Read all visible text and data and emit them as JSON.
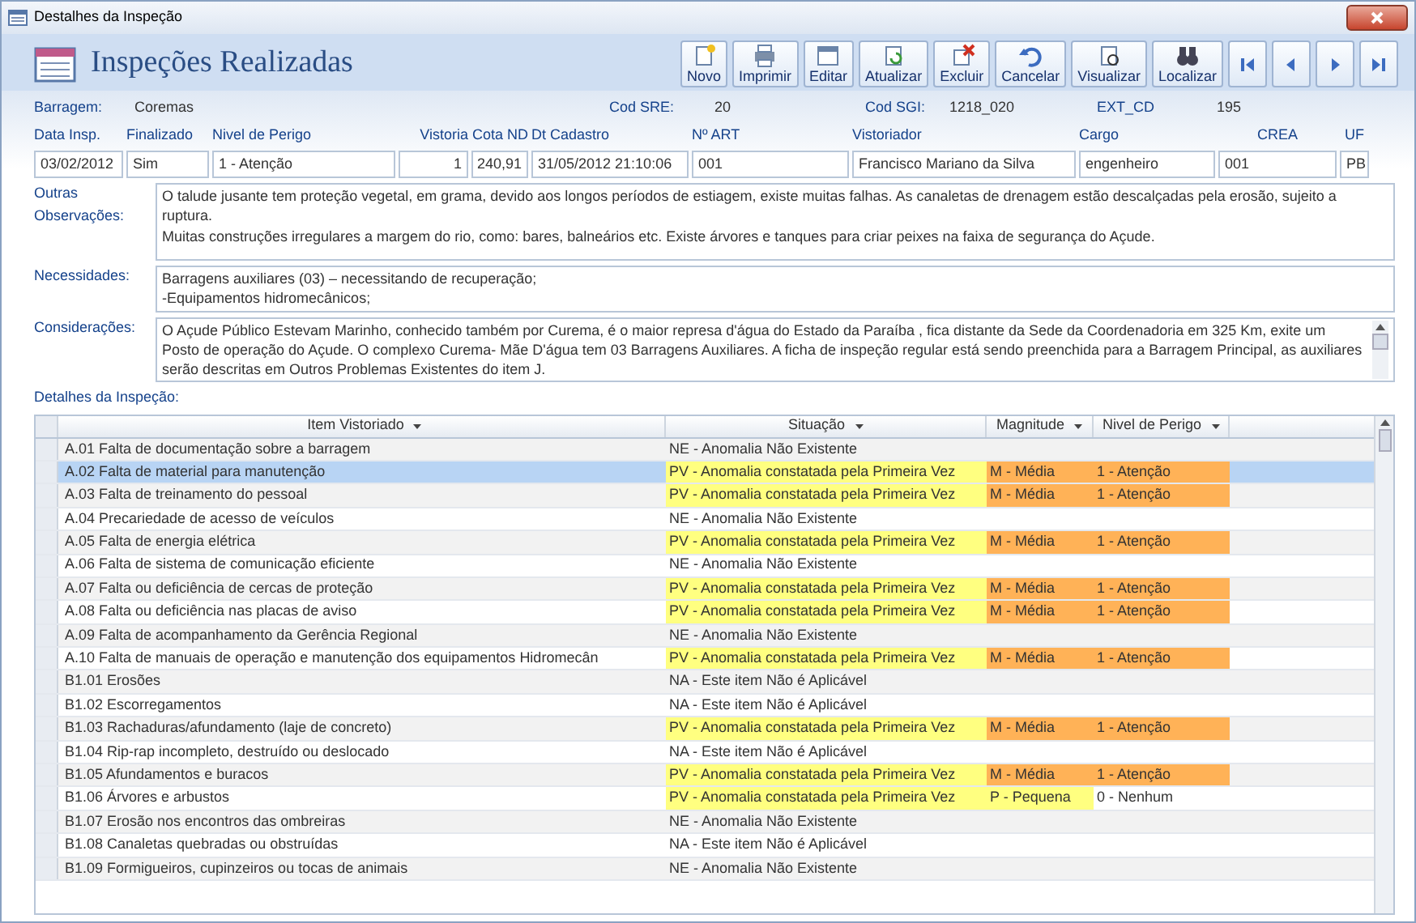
{
  "window": {
    "title": "Destalhes da Inspeção"
  },
  "form_title": "Inspeções Realizadas",
  "toolbar": [
    {
      "label": "Novo",
      "kind": "new"
    },
    {
      "label": "Imprimir",
      "kind": "print"
    },
    {
      "label": "Editar",
      "kind": "edit"
    },
    {
      "label": "Atualizar",
      "kind": "refresh"
    },
    {
      "label": "Excluir",
      "kind": "delete"
    },
    {
      "label": "Cancelar",
      "kind": "undo"
    },
    {
      "label": "Visualizar",
      "kind": "preview"
    },
    {
      "label": "Localizar",
      "kind": "find"
    }
  ],
  "navigation": [
    {
      "kind": "first"
    },
    {
      "kind": "prev"
    },
    {
      "kind": "next"
    },
    {
      "kind": "last"
    }
  ],
  "info": [
    {
      "label": "Barragem:",
      "value": "Coremas"
    },
    {
      "label": "Cod SRE:",
      "value": "20"
    },
    {
      "label": "Cod SGI:",
      "value": "1218_020"
    },
    {
      "label": "EXT_CD",
      "value": "195"
    }
  ],
  "fields": [
    {
      "label": "Data Insp.",
      "value": "03/02/2012"
    },
    {
      "label": "Finalizado",
      "value": "Sim"
    },
    {
      "label": "Nivel de Perigo",
      "value": "1 - Atenção"
    },
    {
      "label": "Vistoria",
      "value": "1"
    },
    {
      "label": "Cota ND",
      "value": "240,91"
    },
    {
      "label": "Dt Cadastro",
      "value": "31/05/2012 21:10:06"
    },
    {
      "label": "Nº ART",
      "value": "001"
    },
    {
      "label": "Vistoriador",
      "value": "Francisco Mariano da Silva"
    },
    {
      "label": "Cargo",
      "value": "engenheiro"
    },
    {
      "label": "CREA",
      "value": "001"
    },
    {
      "label": "UF",
      "value": "PB"
    }
  ],
  "memos": [
    {
      "label": "Outras Observações:",
      "lines": [
        "O talude jusante tem proteção vegetal, em grama, devido aos longos períodos de estiagem, existe muitas falhas. As canaletas de drenagem estão descalçadas pela erosão, sujeito a ruptura.",
        "Muitas construções irregulares a margem do rio, como: bares, balneários etc. Existe árvores e tanques para criar peixes na faixa de segurança do Açude."
      ]
    },
    {
      "label": "Necessidades:",
      "lines": [
        "Barragens auxiliares (03) – necessitando de recuperação;",
        "-Equipamentos hidromecânicos;"
      ]
    },
    {
      "label": "Considerações:",
      "lines": [
        "O Açude Público Estevam Marinho, conhecido também por  Curema, é o maior represa d'água do Estado da Paraíba , fica distante da Sede da Coordenadoria em 325 Km, exite um Posto de operação do Açude. O complexo Curema- Mãe D'água tem 03 Barragens Auxiliares. A ficha de inspeção regular está  sendo preenchida para a Barragem Principal, as auxiliares serão descritas em Outros Problemas Existentes do item J."
      ]
    }
  ],
  "details": {
    "title": "Detalhes da Inspeção:",
    "columns": [
      "Item Vistoriado",
      "Situação",
      "Magnitude",
      "Nivel de Perigo"
    ],
    "rows": [
      {
        "item": "A.01  Falta de documentação sobre a barragem",
        "situation": {
          "text": "NE - Anomalia Não Existente"
        },
        "selected": false
      },
      {
        "item": "A.02  Falta de material para manutenção",
        "situation": {
          "text": "PV - Anomalia constatada pela Primeira Vez",
          "color": "#ffff80"
        },
        "magnitude": {
          "text": "M - Média",
          "color": "#ffb257"
        },
        "danger": {
          "text": "1 - Atenção",
          "color": "#ffb257"
        },
        "selected": true
      },
      {
        "item": "A.03  Falta de treinamento do pessoal",
        "situation": {
          "text": "PV - Anomalia constatada pela Primeira Vez",
          "color": "#ffff80"
        },
        "magnitude": {
          "text": "M - Média",
          "color": "#ffb257"
        },
        "danger": {
          "text": "1 - Atenção",
          "color": "#ffb257"
        },
        "selected": false
      },
      {
        "item": "A.04  Precariedade de acesso de veículos",
        "situation": {
          "text": "NE - Anomalia Não Existente"
        },
        "selected": false
      },
      {
        "item": "A.05  Falta de energia elétrica",
        "situation": {
          "text": "PV - Anomalia constatada pela Primeira Vez",
          "color": "#ffff80"
        },
        "magnitude": {
          "text": "M - Média",
          "color": "#ffb257"
        },
        "danger": {
          "text": "1 - Atenção",
          "color": "#ffb257"
        },
        "selected": false
      },
      {
        "item": "A.06  Falta de sistema de comunicação eficiente",
        "situation": {
          "text": "NE - Anomalia Não Existente"
        },
        "selected": false
      },
      {
        "item": "A.07  Falta ou deficiência de cercas de proteção",
        "situation": {
          "text": "PV - Anomalia constatada pela Primeira Vez",
          "color": "#ffff80"
        },
        "magnitude": {
          "text": "M - Média",
          "color": "#ffb257"
        },
        "danger": {
          "text": "1 - Atenção",
          "color": "#ffb257"
        },
        "selected": false
      },
      {
        "item": "A.08  Falta ou deficiência nas placas de aviso",
        "situation": {
          "text": "PV - Anomalia constatada pela Primeira Vez",
          "color": "#ffff80"
        },
        "magnitude": {
          "text": "M - Média",
          "color": "#ffb257"
        },
        "danger": {
          "text": "1 - Atenção",
          "color": "#ffb257"
        },
        "selected": false
      },
      {
        "item": "A.09  Falta de acompanhamento da Gerência Regional",
        "situation": {
          "text": "NE - Anomalia Não Existente"
        },
        "selected": false
      },
      {
        "item": "A.10  Falta de manuais de operação e manutenção dos equipamentos Hidromecân",
        "situation": {
          "text": "PV - Anomalia constatada pela Primeira Vez",
          "color": "#ffff80"
        },
        "magnitude": {
          "text": "M - Média",
          "color": "#ffb257"
        },
        "danger": {
          "text": "1 - Atenção",
          "color": "#ffb257"
        },
        "selected": false
      },
      {
        "item": "B1.01  Erosões",
        "situation": {
          "text": "NA - Este item Não é Aplicável"
        },
        "selected": false
      },
      {
        "item": "B1.02  Escorregamentos",
        "situation": {
          "text": "NA - Este item Não é Aplicável"
        },
        "selected": false
      },
      {
        "item": "B1.03  Rachaduras/afundamento (laje de concreto)",
        "situation": {
          "text": "PV - Anomalia constatada pela Primeira Vez",
          "color": "#ffff80"
        },
        "magnitude": {
          "text": "M - Média",
          "color": "#ffb257"
        },
        "danger": {
          "text": "1 - Atenção",
          "color": "#ffb257"
        },
        "selected": false
      },
      {
        "item": "B1.04  Rip-rap incompleto, destruído ou deslocado",
        "situation": {
          "text": "NA - Este item Não é Aplicável"
        },
        "selected": false
      },
      {
        "item": "B1.05  Afundamentos e buracos",
        "situation": {
          "text": "PV - Anomalia constatada pela Primeira Vez",
          "color": "#ffff80"
        },
        "magnitude": {
          "text": "M - Média",
          "color": "#ffb257"
        },
        "danger": {
          "text": "1 - Atenção",
          "color": "#ffb257"
        },
        "selected": false
      },
      {
        "item": "B1.06  Árvores e arbustos",
        "situation": {
          "text": "PV - Anomalia constatada pela Primeira Vez",
          "color": "#ffff80"
        },
        "magnitude": {
          "text": "P - Pequena",
          "color": "#ffff80"
        },
        "danger": {
          "text": "0 - Nenhum"
        },
        "selected": false
      },
      {
        "item": "B1.07  Erosão nos encontros das ombreiras",
        "situation": {
          "text": "NE - Anomalia Não Existente"
        },
        "selected": false
      },
      {
        "item": "B1.08  Canaletas quebradas ou obstruídas",
        "situation": {
          "text": "NA - Este item Não é Aplicável"
        },
        "selected": false
      },
      {
        "item": "B1.09  Formigueiros, cupinzeiros ou tocas de animais",
        "situation": {
          "text": "NE - Anomalia Não Existente"
        },
        "selected": false
      }
    ]
  }
}
